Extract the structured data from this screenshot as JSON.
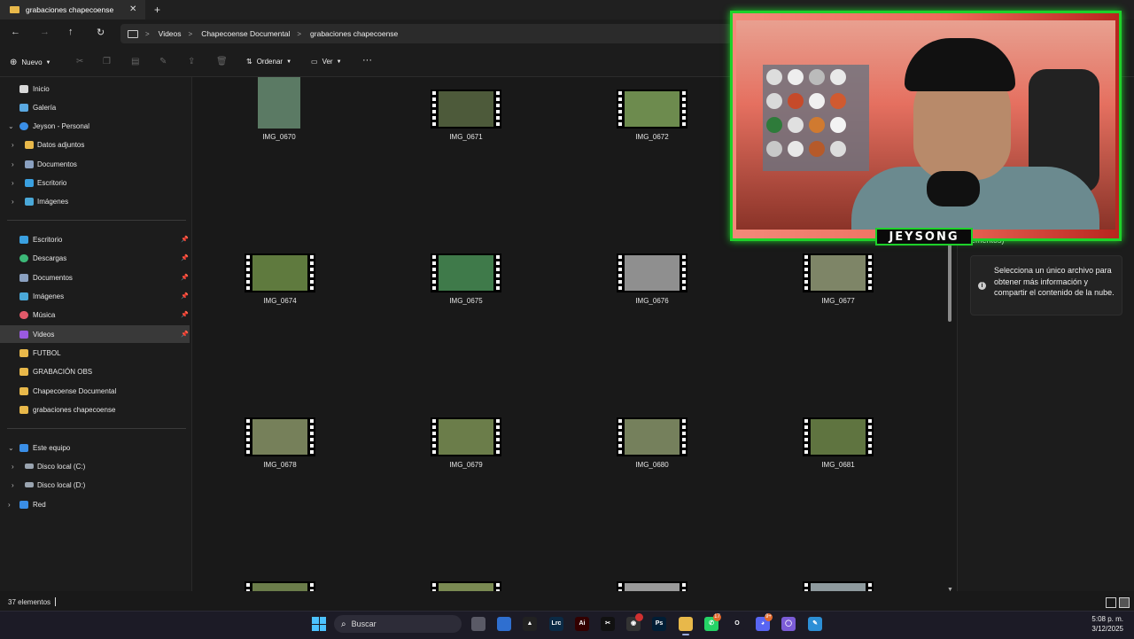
{
  "window": {
    "tab_title": "grabaciones chapecoense",
    "close_glyph": "✕",
    "new_tab_glyph": "+"
  },
  "address_bar": {
    "crumbs": [
      "Videos",
      "Chapecoense Documental",
      "grabaciones chapecoense"
    ],
    "separator": ">"
  },
  "command_bar": {
    "new_label": "Nuevo",
    "sort_label": "Ordenar",
    "view_label": "Ver",
    "more_glyph": "···"
  },
  "sidebar": {
    "top": [
      {
        "label": "Inicio",
        "icon": "home-icon"
      },
      {
        "label": "Galería",
        "icon": "gallery-icon"
      },
      {
        "label": "Jeyson - Personal",
        "icon": "cloud-icon",
        "expanded": true
      }
    ],
    "onedrive_children": [
      {
        "label": "Datos adjuntos",
        "icon": "folder-icon"
      },
      {
        "label": "Documentos",
        "icon": "document-icon"
      },
      {
        "label": "Escritorio",
        "icon": "desktop-icon"
      },
      {
        "label": "Imágenes",
        "icon": "pictures-icon"
      }
    ],
    "quick_access": [
      {
        "label": "Escritorio",
        "pinned": true
      },
      {
        "label": "Descargas",
        "pinned": true
      },
      {
        "label": "Documentos",
        "pinned": true
      },
      {
        "label": "Imágenes",
        "pinned": true
      },
      {
        "label": "Música",
        "pinned": true
      },
      {
        "label": "Videos",
        "pinned": true,
        "selected": true
      },
      {
        "label": "FUTBOL"
      },
      {
        "label": "GRABACIÓN OBS"
      },
      {
        "label": "Chapecoense Documental"
      },
      {
        "label": "grabaciones chapecoense"
      }
    ],
    "this_pc": {
      "label": "Este equipo"
    },
    "drives": [
      {
        "label": "Disco local (C:)"
      },
      {
        "label": "Disco local (D:)"
      }
    ],
    "network": {
      "label": "Red"
    }
  },
  "files": [
    {
      "name": "IMG_0670",
      "kind": "image",
      "color": "#5b7a64"
    },
    {
      "name": "IMG_0671",
      "kind": "video",
      "color": "#4d5a3a"
    },
    {
      "name": "IMG_0672",
      "kind": "video",
      "color": "#6d8b4e"
    },
    {
      "name": "IMG_0674",
      "kind": "video",
      "color": "#5f7a3e"
    },
    {
      "name": "IMG_0675",
      "kind": "video",
      "color": "#3f7a4a"
    },
    {
      "name": "IMG_0676",
      "kind": "video",
      "color": "#8f8f8f"
    },
    {
      "name": "IMG_0677",
      "kind": "video",
      "color": "#7e8567"
    },
    {
      "name": "IMG_0678",
      "kind": "video",
      "color": "#76805a"
    },
    {
      "name": "IMG_0679",
      "kind": "video",
      "color": "#6b7d4a"
    },
    {
      "name": "IMG_0680",
      "kind": "video",
      "color": "#75805c"
    },
    {
      "name": "IMG_0681",
      "kind": "video",
      "color": "#5f7440"
    }
  ],
  "details_pane": {
    "heading_partial": "ementos)",
    "message": "Selecciona un único archivo para obtener más información y compartir el contenido de la nube.",
    "info_glyph": "i"
  },
  "status_bar": {
    "count": "37 elementos"
  },
  "overlay": {
    "streamer_name": "JEYSONG",
    "accent": "#1ed12a"
  },
  "taskbar": {
    "search_placeholder": "Buscar",
    "apps": [
      {
        "name": "task-view-icon",
        "color": "#5a5a66",
        "glyph": ""
      },
      {
        "name": "store-icon",
        "color": "#2f6fd0",
        "glyph": ""
      },
      {
        "name": "capcut-icon",
        "color": "#222222",
        "glyph": "▲"
      },
      {
        "name": "lightroom-icon",
        "color": "#0b2a45",
        "glyph": "Lrc"
      },
      {
        "name": "illustrator-icon",
        "color": "#330000",
        "glyph": "Ai"
      },
      {
        "name": "capcut-app-icon",
        "color": "#111111",
        "glyph": "✂"
      },
      {
        "name": "obs-icon",
        "color": "#333333",
        "glyph": "◉",
        "badge": ""
      },
      {
        "name": "photoshop-icon",
        "color": "#001e36",
        "glyph": "Ps"
      },
      {
        "name": "file-explorer-icon",
        "color": "#e8b84a",
        "glyph": "",
        "active": true
      },
      {
        "name": "whatsapp-icon",
        "color": "#25d366",
        "glyph": "✆",
        "badge": "17"
      },
      {
        "name": "opera-icon",
        "color": "#1c1b26",
        "glyph": "O"
      },
      {
        "name": "discord-icon",
        "color": "#5865f2",
        "glyph": "◕",
        "badge": "9+"
      },
      {
        "name": "circle-app-icon",
        "color": "#7b5cd6",
        "glyph": "◯"
      },
      {
        "name": "snipping-icon",
        "color": "#2c8fd6",
        "glyph": "✎"
      }
    ],
    "clock_time": "5:08 p. m.",
    "clock_date": "3/12/2025"
  }
}
